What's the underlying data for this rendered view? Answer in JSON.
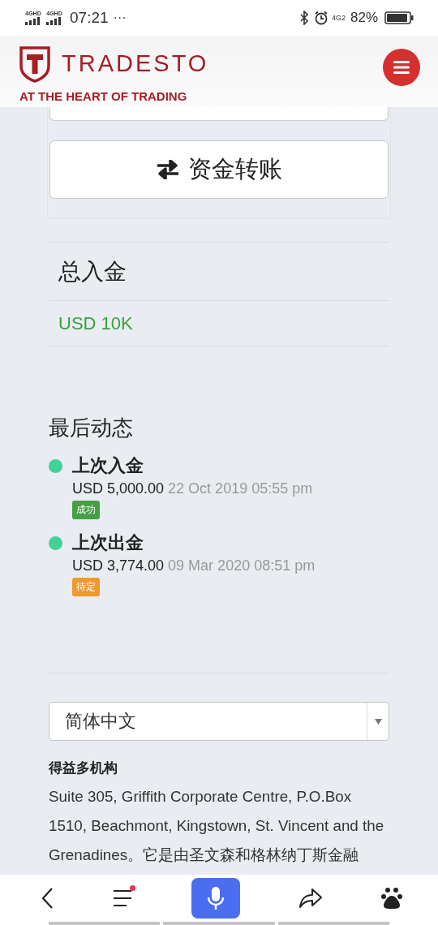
{
  "status_bar": {
    "signals": [
      "4GHD",
      "4GHD"
    ],
    "time": "07:21",
    "more": "···",
    "network": "4G2",
    "battery": "82%"
  },
  "header": {
    "brand": "TRADESTO",
    "tagline": "AT THE HEART OF TRADING"
  },
  "transfer_button": {
    "label": "资金转账"
  },
  "total_deposit": {
    "title": "总入金",
    "value": "USD 10K"
  },
  "recent_activity": {
    "title": "最后动态",
    "items": [
      {
        "title": "上次入金",
        "amount": "USD 5,000.00",
        "date": "22 Oct 2019 05:55 pm",
        "kind": "success",
        "badge": "成功"
      },
      {
        "title": "上次出金",
        "amount": "USD 3,774.00",
        "date": "09 Mar 2020 08:51 pm",
        "kind": "pending",
        "badge": "待定"
      }
    ]
  },
  "language_select": {
    "value": "简体中文"
  },
  "footer": {
    "company": "得益多机构",
    "address": "Suite 305, Griffith Corporate Centre, P.O.Box 1510, Beachmont, Kingstown, St. Vincent and the Grenadines。它是由圣文森和格林纳丁斯金融"
  },
  "bottom_nav": {
    "items": [
      {
        "kind": "back"
      },
      {
        "kind": "menu",
        "notification": true
      },
      {
        "kind": "voice"
      },
      {
        "kind": "share"
      },
      {
        "kind": "paw"
      }
    ]
  }
}
